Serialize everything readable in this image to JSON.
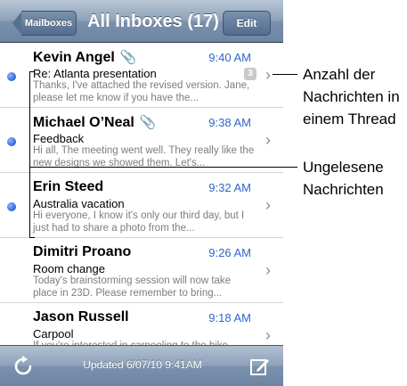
{
  "header": {
    "back_label": "Mailboxes",
    "title": "All Inboxes (17)",
    "edit_label": "Edit"
  },
  "messages": [
    {
      "sender": "Kevin Angel",
      "has_attachment": true,
      "time": "9:40 AM",
      "subject": "Re: Atlanta presentation",
      "preview": "Thanks, I've attached the revised version. Jane, please let me know if you have the...",
      "unread": true,
      "thread_count": "3"
    },
    {
      "sender": "Michael O’Neal",
      "has_attachment": true,
      "time": "9:38 AM",
      "subject": "Feedback",
      "preview": "Hi all, The meeting went well. They really like the new designs we showed them. Let's...",
      "unread": true
    },
    {
      "sender": "Erin Steed",
      "has_attachment": false,
      "time": "9:32 AM",
      "subject": "Australia vacation",
      "preview": "Hi everyone, I know it's only our third day, but I just had to share a photo from the...",
      "unread": true
    },
    {
      "sender": "Dimitri Proano",
      "has_attachment": false,
      "time": "9:26 AM",
      "subject": "Room change",
      "preview": "Today's brainstorming session will now take place in 23D. Please remember to bring...",
      "unread": false
    },
    {
      "sender": "Jason Russell",
      "has_attachment": false,
      "time": "9:18 AM",
      "subject": "Carpool",
      "preview": "If you're interested in carpooling to the hike tomorrow...",
      "unread": false
    }
  ],
  "toolbar": {
    "status": "Updated 6/07/10 9:41AM",
    "refresh_icon": "refresh-icon",
    "compose_icon": "compose-icon"
  },
  "callouts": {
    "thread_count": [
      "Anzahl der",
      "Nachrichten in",
      "einem Thread"
    ],
    "unread": [
      "Ungelesene",
      "Nachrichten"
    ]
  },
  "colors": {
    "accent": "#2f66c7",
    "unread_dot": "#2c63d6",
    "bar": "#7a91ad"
  }
}
